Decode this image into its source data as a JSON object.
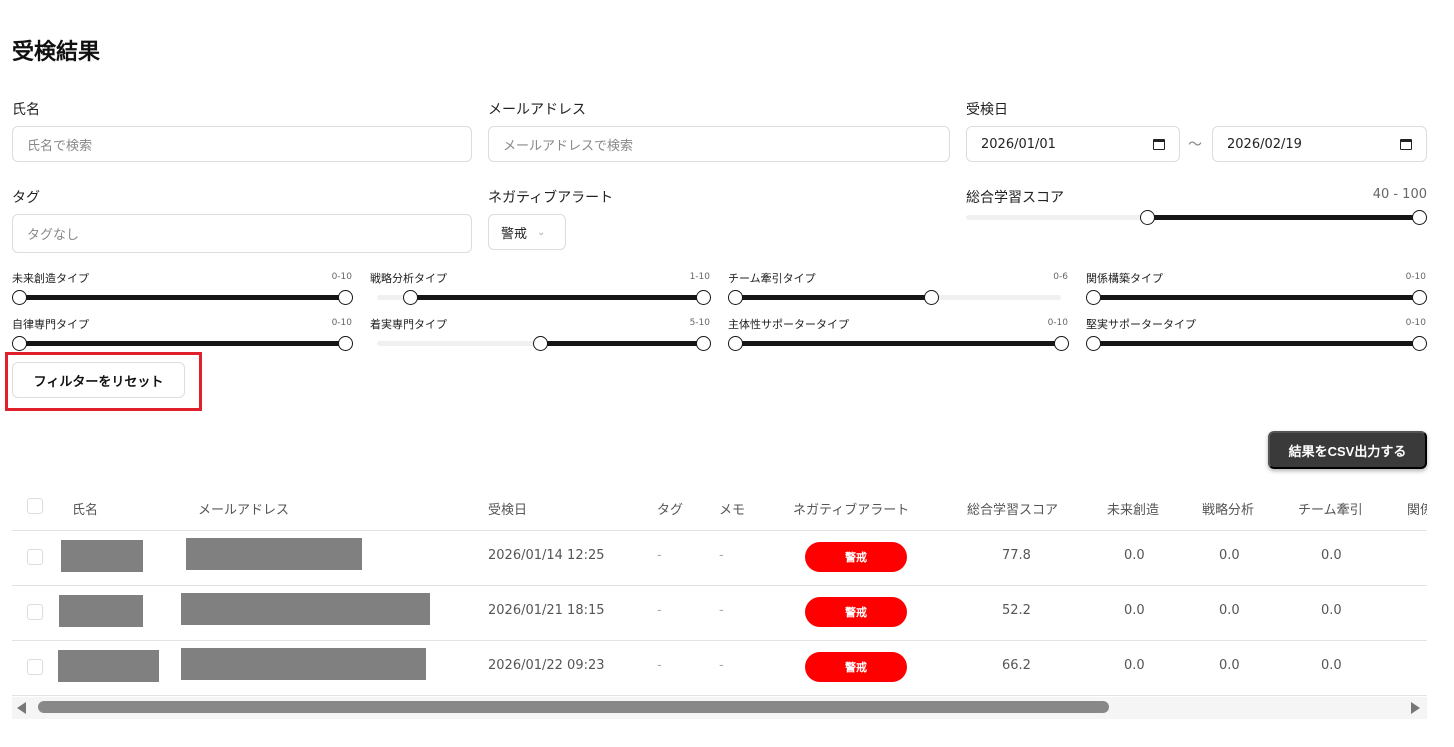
{
  "page_title": "受検結果",
  "filters": {
    "name_label": "氏名",
    "name_placeholder": "氏名で検索",
    "email_label": "メールアドレス",
    "email_placeholder": "メールアドレスで検索",
    "date_label": "受検日",
    "date_from": "2026/01/01",
    "date_sep": "〜",
    "date_to": "2026/02/19",
    "tag_label": "タグ",
    "tag_placeholder": "タグなし",
    "alert_label": "ネガティブアラート",
    "alert_value": "警戒",
    "score_label": "総合学習スコア",
    "score_range": "40 - 100",
    "score_low": 0.4,
    "score_high": 1.0,
    "type_sliders": [
      {
        "label": "未来創造タイプ",
        "range": "0-10",
        "low": 0,
        "high": 1
      },
      {
        "label": "戦略分析タイプ",
        "range": "1-10",
        "low": 0.1,
        "high": 1
      },
      {
        "label": "チーム牽引タイプ",
        "range": "0-6",
        "low": 0,
        "high": 0.6
      },
      {
        "label": "関係構築タイプ",
        "range": "0-10",
        "low": 0,
        "high": 1
      },
      {
        "label": "自律専門タイプ",
        "range": "0-10",
        "low": 0,
        "high": 1
      },
      {
        "label": "着実専門タイプ",
        "range": "5-10",
        "low": 0.5,
        "high": 1
      },
      {
        "label": "主体性サポータータイプ",
        "range": "0-10",
        "low": 0,
        "high": 1
      },
      {
        "label": "堅実サポータータイプ",
        "range": "0-10",
        "low": 0,
        "high": 1
      }
    ],
    "reset_label": "フィルターをリセット"
  },
  "csv_label": "結果をCSV出力する",
  "table": {
    "headers": [
      "氏名",
      "メールアドレス",
      "受検日",
      "タグ",
      "メモ",
      "ネガティブアラート",
      "総合学習スコア",
      "未来創造",
      "戦略分析",
      "チーム牽引",
      "関係"
    ],
    "rows": [
      {
        "date": "2026/01/14 12:25",
        "tag": "-",
        "memo": "-",
        "alert": "警戒",
        "score": "77.8",
        "c1": "0.0",
        "c2": "0.0",
        "c3": "0.0"
      },
      {
        "date": "2026/01/21 18:15",
        "tag": "-",
        "memo": "-",
        "alert": "警戒",
        "score": "52.2",
        "c1": "0.0",
        "c2": "0.0",
        "c3": "0.0"
      },
      {
        "date": "2026/01/22 09:23",
        "tag": "-",
        "memo": "-",
        "alert": "警戒",
        "score": "66.2",
        "c1": "0.0",
        "c2": "0.0",
        "c3": "0.0"
      }
    ]
  }
}
